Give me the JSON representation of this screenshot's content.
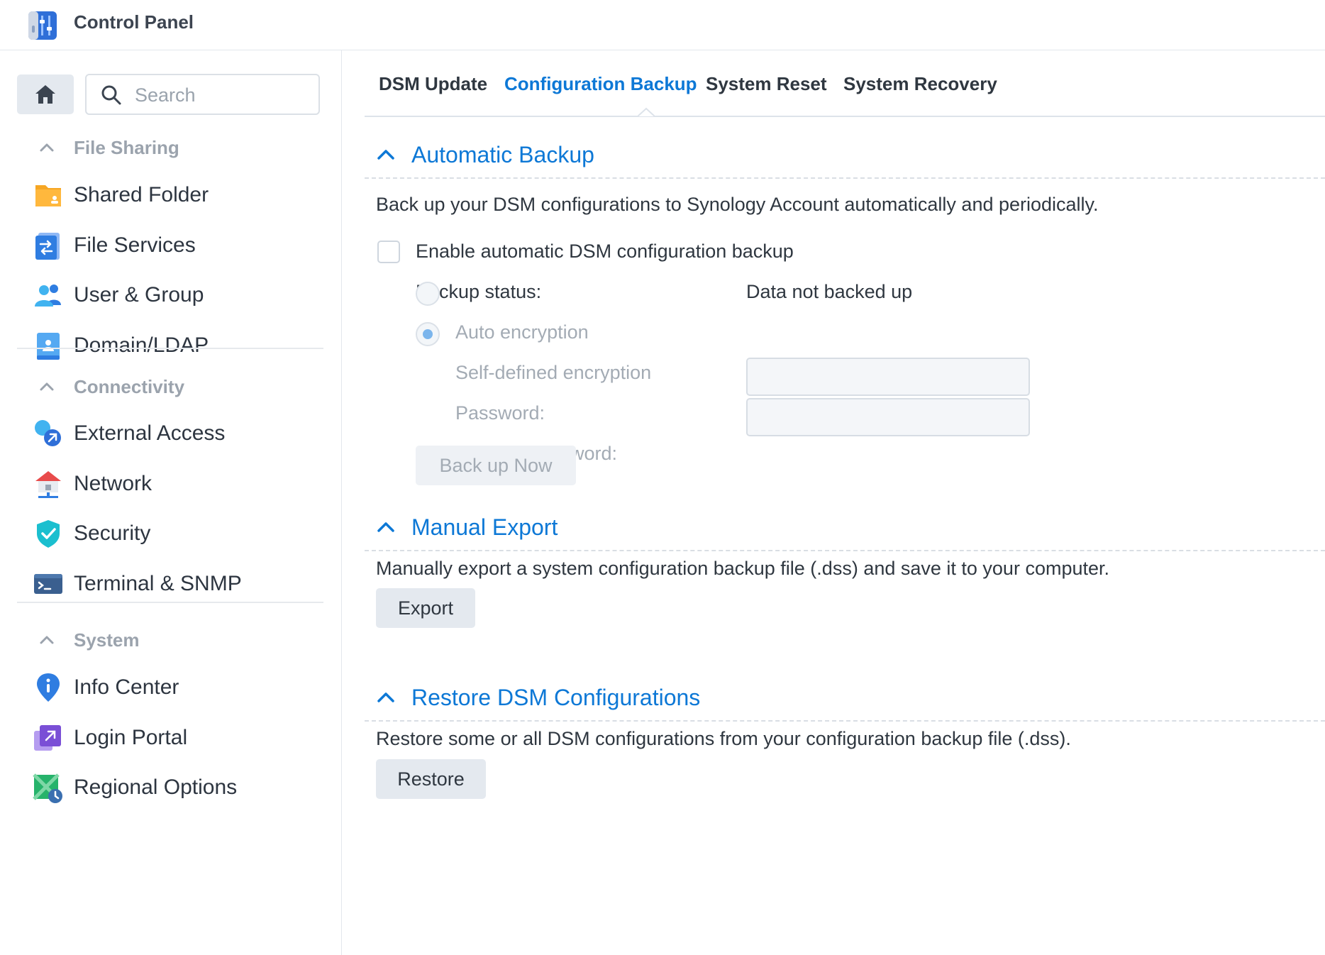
{
  "app": {
    "title": "Control Panel",
    "icon": "control-panel-icon"
  },
  "sidebar": {
    "search_placeholder": "Search",
    "groups": [
      {
        "label": "File Sharing",
        "items": [
          {
            "label": "Shared Folder",
            "icon": "shared-folder-icon"
          },
          {
            "label": "File Services",
            "icon": "file-services-icon"
          },
          {
            "label": "User & Group",
            "icon": "user-group-icon"
          },
          {
            "label": "Domain/LDAP",
            "icon": "domain-ldap-icon"
          }
        ]
      },
      {
        "label": "Connectivity",
        "items": [
          {
            "label": "External Access",
            "icon": "external-access-icon"
          },
          {
            "label": "Network",
            "icon": "network-icon"
          },
          {
            "label": "Security",
            "icon": "security-shield-icon"
          },
          {
            "label": "Terminal & SNMP",
            "icon": "terminal-icon"
          }
        ]
      },
      {
        "label": "System",
        "items": [
          {
            "label": "Info Center",
            "icon": "info-center-icon"
          },
          {
            "label": "Login Portal",
            "icon": "login-portal-icon"
          },
          {
            "label": "Regional Options",
            "icon": "regional-options-icon"
          }
        ]
      }
    ]
  },
  "tabs": [
    {
      "label": "DSM Update",
      "active": false
    },
    {
      "label": "Configuration Backup",
      "active": true
    },
    {
      "label": "System Reset",
      "active": false
    },
    {
      "label": "System Recovery",
      "active": false
    }
  ],
  "automatic_backup": {
    "title": "Automatic Backup",
    "description": "Back up your DSM configurations to Synology Account automatically and periodically.",
    "enable_label": "Enable automatic DSM configuration backup",
    "enable_checked": false,
    "status_label": "Backup status:",
    "status_value": "Data not backed up",
    "auto_encryption_label": "Auto encryption",
    "self_encryption_label": "Self-defined encryption",
    "selected_encryption": "self-defined",
    "password_label": "Password:",
    "confirm_password_label": "Confirm Password:",
    "backup_button": "Back up Now"
  },
  "manual_export": {
    "title": "Manual Export",
    "description": "Manually export a system configuration backup file (.dss) and save it to your computer.",
    "export_button": "Export"
  },
  "restore": {
    "title": "Restore DSM Configurations",
    "description": "Restore some or all DSM configurations from your configuration backup file (.dss).",
    "restore_button": "Restore"
  },
  "colors": {
    "accent": "#0d78d6",
    "disabled_text": "#a3abb4",
    "button_bg": "#e4e9ef"
  }
}
